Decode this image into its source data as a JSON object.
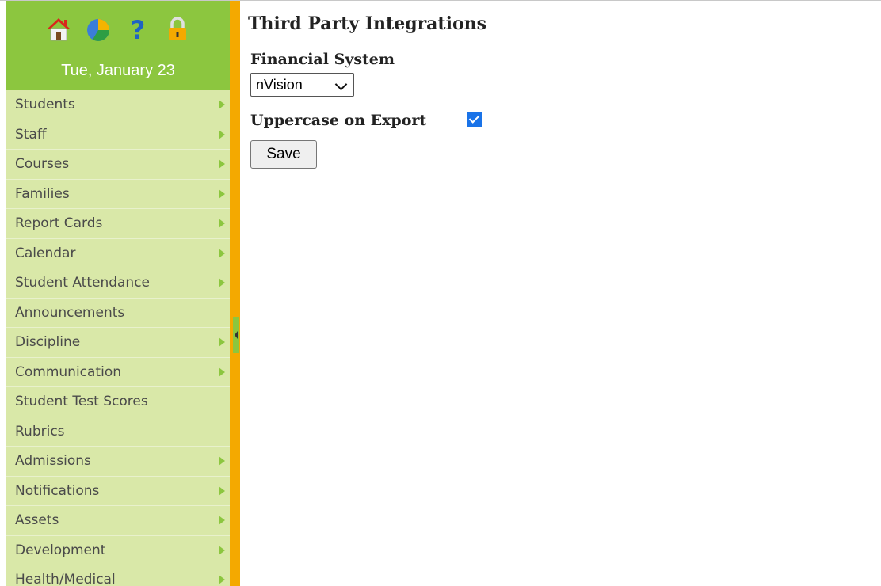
{
  "sidebar": {
    "icons": [
      "home-icon",
      "pie-chart-icon",
      "help-icon",
      "lock-icon"
    ],
    "date": "Tue, January 23",
    "items": [
      {
        "label": "Students",
        "has_submenu": true
      },
      {
        "label": "Staff",
        "has_submenu": true
      },
      {
        "label": "Courses",
        "has_submenu": true
      },
      {
        "label": "Families",
        "has_submenu": true
      },
      {
        "label": "Report Cards",
        "has_submenu": true
      },
      {
        "label": "Calendar",
        "has_submenu": true
      },
      {
        "label": "Student Attendance",
        "has_submenu": true
      },
      {
        "label": "Announcements",
        "has_submenu": false
      },
      {
        "label": "Discipline",
        "has_submenu": true
      },
      {
        "label": "Communication",
        "has_submenu": true
      },
      {
        "label": "Student Test Scores",
        "has_submenu": false
      },
      {
        "label": "Rubrics",
        "has_submenu": false
      },
      {
        "label": "Admissions",
        "has_submenu": true
      },
      {
        "label": "Notifications",
        "has_submenu": true
      },
      {
        "label": "Assets",
        "has_submenu": true
      },
      {
        "label": "Development",
        "has_submenu": true
      },
      {
        "label": "Health/Medical",
        "has_submenu": true
      }
    ]
  },
  "main": {
    "title": "Third Party Integrations",
    "financial_system": {
      "label": "Financial System",
      "selected": "nVision"
    },
    "uppercase_export": {
      "label": "Uppercase on Export",
      "checked": true
    },
    "save_label": "Save"
  },
  "colors": {
    "header_green": "#8cc63f",
    "sidebar_bg": "#d9e8a8",
    "divider_orange": "#f4a900",
    "checkbox_blue": "#1a73e8"
  }
}
